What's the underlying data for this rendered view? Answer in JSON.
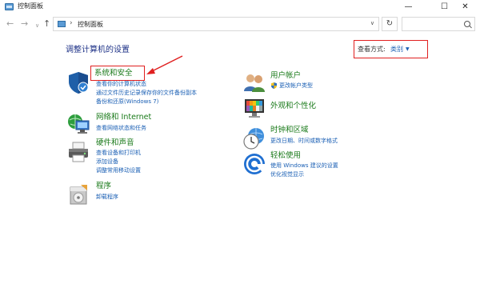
{
  "window": {
    "title": "控制面板",
    "minimize_glyph": "—",
    "maximize_glyph": "☐",
    "close_glyph": "✕"
  },
  "nav": {
    "back_glyph": "←",
    "forward_glyph": "→",
    "recent_glyph": "∨",
    "up_glyph": "↑",
    "address_separator": "›",
    "address": "控制面板",
    "address_dropdown_glyph": "∨",
    "refresh_glyph": "↻",
    "search_placeholder": ""
  },
  "page": {
    "title": "调整计算机的设置",
    "view_by_label": "查看方式:",
    "view_by_value": "类别",
    "view_by_arrow": "▼"
  },
  "categories_left": [
    {
      "title": "系统和安全",
      "icon": "shield-icon",
      "links": [
        "查看你的计算机状态",
        "通过文件历史记录保存你的文件备份副本",
        "备份和还原(Windows 7)"
      ]
    },
    {
      "title": "网络和 Internet",
      "icon": "network-icon",
      "links": [
        "查看网络状态和任务"
      ]
    },
    {
      "title": "硬件和声音",
      "icon": "printer-icon",
      "links": [
        "查看设备和打印机",
        "添加设备",
        "调整常用移动设置"
      ]
    },
    {
      "title": "程序",
      "icon": "programs-icon",
      "links": [
        "卸载程序"
      ]
    }
  ],
  "categories_right": [
    {
      "title": "用户帐户",
      "icon": "users-icon",
      "links": [
        "更改帐户类型"
      ]
    },
    {
      "title": "外观和个性化",
      "icon": "appearance-icon",
      "links": []
    },
    {
      "title": "时钟和区域",
      "icon": "clock-icon",
      "links": [
        "更改日期、时间或数字格式"
      ]
    },
    {
      "title": "轻松使用",
      "icon": "accessibility-icon",
      "links": [
        "使用 Windows 建议的设置",
        "优化视觉显示"
      ]
    }
  ],
  "colors": {
    "annotation_red": "#e02020",
    "link_blue": "#1a5fb4",
    "title_green": "#1a7a1a",
    "heading_blue": "#1e3287"
  }
}
